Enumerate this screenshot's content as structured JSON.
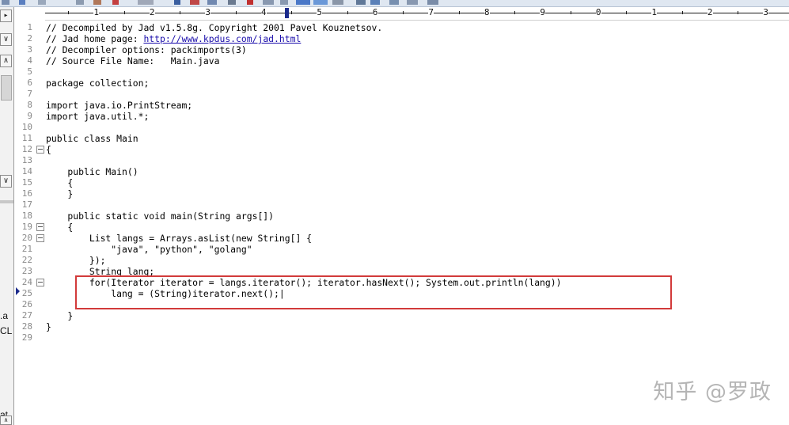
{
  "left_pane": {
    "buttons": [
      "▸",
      "∨",
      "∧",
      "∨",
      "∧"
    ],
    "snippets": [
      ".a",
      "CL",
      "at"
    ]
  },
  "ruler": {
    "labels": [
      "1",
      "2",
      "3",
      "4",
      "5",
      "6",
      "7",
      "8",
      "9",
      "0",
      "1",
      "2",
      "3"
    ]
  },
  "editor": {
    "lines": [
      {
        "n": "1",
        "text": "// Decompiled by Jad v1.5.8g. Copyright 2001 Pavel Kouznetsov."
      },
      {
        "n": "2",
        "text": "// Jad home page: ",
        "link": "http://www.kpdus.com/jad.html"
      },
      {
        "n": "3",
        "text": "// Decompiler options: packimports(3)"
      },
      {
        "n": "4",
        "text": "// Source File Name:   Main.java"
      },
      {
        "n": "5",
        "text": ""
      },
      {
        "n": "6",
        "text": "package collection;"
      },
      {
        "n": "7",
        "text": ""
      },
      {
        "n": "8",
        "text": "import java.io.PrintStream;"
      },
      {
        "n": "9",
        "text": "import java.util.*;"
      },
      {
        "n": "10",
        "text": ""
      },
      {
        "n": "11",
        "text": "public class Main"
      },
      {
        "n": "12",
        "text": "{",
        "fold": true
      },
      {
        "n": "13",
        "text": ""
      },
      {
        "n": "14",
        "text": "    public Main()"
      },
      {
        "n": "15",
        "text": "    {"
      },
      {
        "n": "16",
        "text": "    }"
      },
      {
        "n": "17",
        "text": ""
      },
      {
        "n": "18",
        "text": "    public static void main(String args[])"
      },
      {
        "n": "19",
        "text": "    {",
        "fold": true
      },
      {
        "n": "20",
        "text": "        List langs = Arrays.asList(new String[] {",
        "fold": true
      },
      {
        "n": "21",
        "text": "            \"java\", \"python\", \"golang\""
      },
      {
        "n": "22",
        "text": "        });"
      },
      {
        "n": "23",
        "text": "        String lang;"
      },
      {
        "n": "24",
        "text": "        for(Iterator iterator = langs.iterator(); iterator.hasNext(); System.out.println(lang))",
        "fold": true
      },
      {
        "n": "25",
        "text": "            lang = (String)iterator.next();|"
      },
      {
        "n": "26",
        "text": ""
      },
      {
        "n": "27",
        "text": "    }"
      },
      {
        "n": "28",
        "text": "}"
      },
      {
        "n": "29",
        "text": ""
      }
    ]
  },
  "watermark": "知乎 @罗政",
  "colors": {
    "highlight": "#d23a3a",
    "link": "#1a0dab",
    "line_number": "#8a8a8a"
  }
}
